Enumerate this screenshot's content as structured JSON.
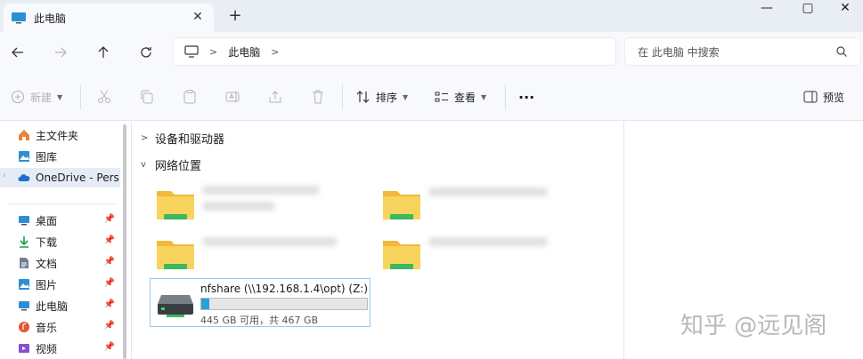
{
  "tab": {
    "title": "此电脑",
    "close": "✕",
    "new_tab": "+"
  },
  "window": {
    "minimize": "—",
    "maximize": "▢",
    "close": "✕"
  },
  "nav": {
    "crumbs": [
      "此电脑"
    ]
  },
  "search": {
    "placeholder": "在 此电脑 中搜索"
  },
  "toolbar": {
    "new_label": "新建",
    "sort_label": "排序",
    "view_label": "查看",
    "more_label": "···",
    "preview_label": "预览"
  },
  "sidebar": {
    "items": [
      {
        "label": "主文件夹",
        "icon": "home-icon"
      },
      {
        "label": "图库",
        "icon": "gallery-icon"
      },
      {
        "label": "OneDrive - Pers",
        "icon": "onedrive-icon"
      },
      {
        "label": "桌面",
        "icon": "desktop-icon"
      },
      {
        "label": "下载",
        "icon": "download-icon"
      },
      {
        "label": "文档",
        "icon": "document-icon"
      },
      {
        "label": "图片",
        "icon": "pictures-icon"
      },
      {
        "label": "此电脑",
        "icon": "pc-icon"
      },
      {
        "label": "音乐",
        "icon": "music-icon"
      },
      {
        "label": "视频",
        "icon": "video-icon"
      }
    ]
  },
  "content": {
    "groups": [
      {
        "label": "设备和驱动器",
        "expanded": false
      },
      {
        "label": "网络位置",
        "expanded": true
      }
    ],
    "drive": {
      "name": "nfshare (\\\\192.168.1.4\\opt) (Z:)",
      "free_text": "445 GB 可用，共 467 GB",
      "used_fraction": 0.047
    }
  },
  "colors": {
    "accent": "#26a0da",
    "folder": "#f6c94a",
    "folder_badge": "#3cb85e",
    "selected": "#e5ecf6"
  },
  "watermark": "知乎 @远见阁"
}
